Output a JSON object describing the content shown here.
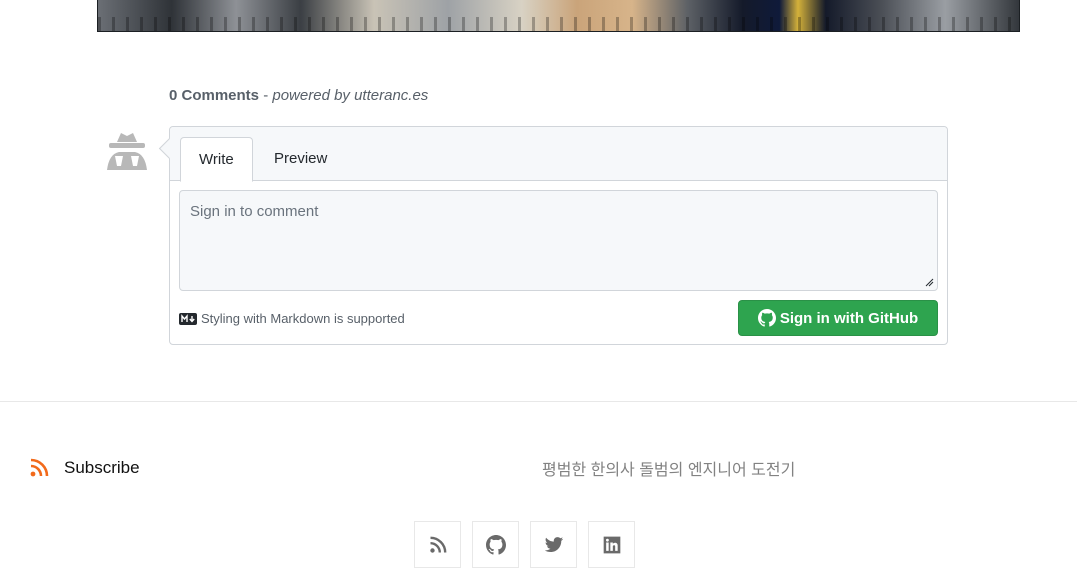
{
  "comments": {
    "count_label": "0 Comments",
    "separator": " - ",
    "powered_by": "powered by utteranc.es",
    "tabs": [
      "Write",
      "Preview"
    ],
    "input_placeholder": "Sign in to comment",
    "markdown_hint": "Styling with Markdown is supported",
    "signin_button": "Sign in with GitHub"
  },
  "footer": {
    "subscribe_label": "Subscribe",
    "tagline": "평범한 한의사 돌범의 엔지니어 도전기",
    "social": [
      "rss-icon",
      "github-icon",
      "twitter-icon",
      "linkedin-icon"
    ]
  },
  "colors": {
    "signin_green": "#2ea44f",
    "rss_orange": "#f26a1b",
    "muted_text": "#586069"
  }
}
